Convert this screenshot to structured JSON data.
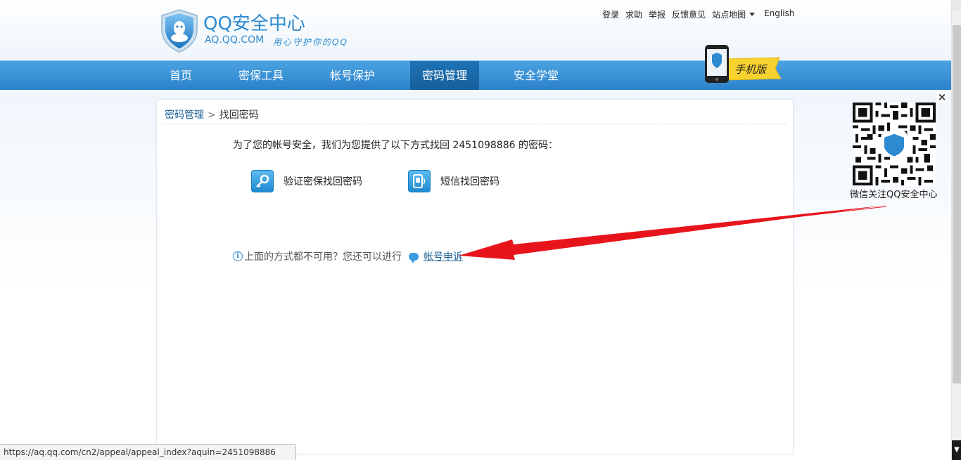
{
  "brand": {
    "title": "QQ安全中心",
    "domain": "AQ.QQ.COM",
    "slogan": "用心守护你的QQ"
  },
  "toplinks": {
    "login": "登录",
    "help": "求助",
    "report": "举报",
    "feedback": "反馈意见",
    "sitemap": "站点地图",
    "english": "English"
  },
  "nav": {
    "items": [
      "首页",
      "密保工具",
      "帐号保护",
      "密码管理",
      "安全学堂"
    ],
    "active_index": 3
  },
  "mobile_badge": "手机版",
  "breadcrumb": {
    "parent": "密码管理",
    "separator": ">",
    "current": "找回密码"
  },
  "content": {
    "intro": "为了您的帐号安全，我们为您提供了以下方式找回 2451098886 的密码：",
    "methods": [
      {
        "icon": "key-icon",
        "label": "验证密保找回密码"
      },
      {
        "icon": "phone-sms-icon",
        "label": "短信找回密码"
      }
    ],
    "alt_text": "上面的方式都不可用？您还可以进行",
    "appeal_link": "帐号申诉"
  },
  "qr": {
    "caption": "微信关注QQ安全中心",
    "close": "×"
  },
  "statusbar": {
    "url": "https://aq.qq.com/cn2/appeal/appeal_index?aquin=2451098886"
  },
  "colors": {
    "brand_blue": "#2e8ad0",
    "nav_blue": "#3a92d6",
    "nav_active": "#1a6aa9",
    "link": "#1a5f94",
    "annotation_arrow": "#e8141c"
  }
}
